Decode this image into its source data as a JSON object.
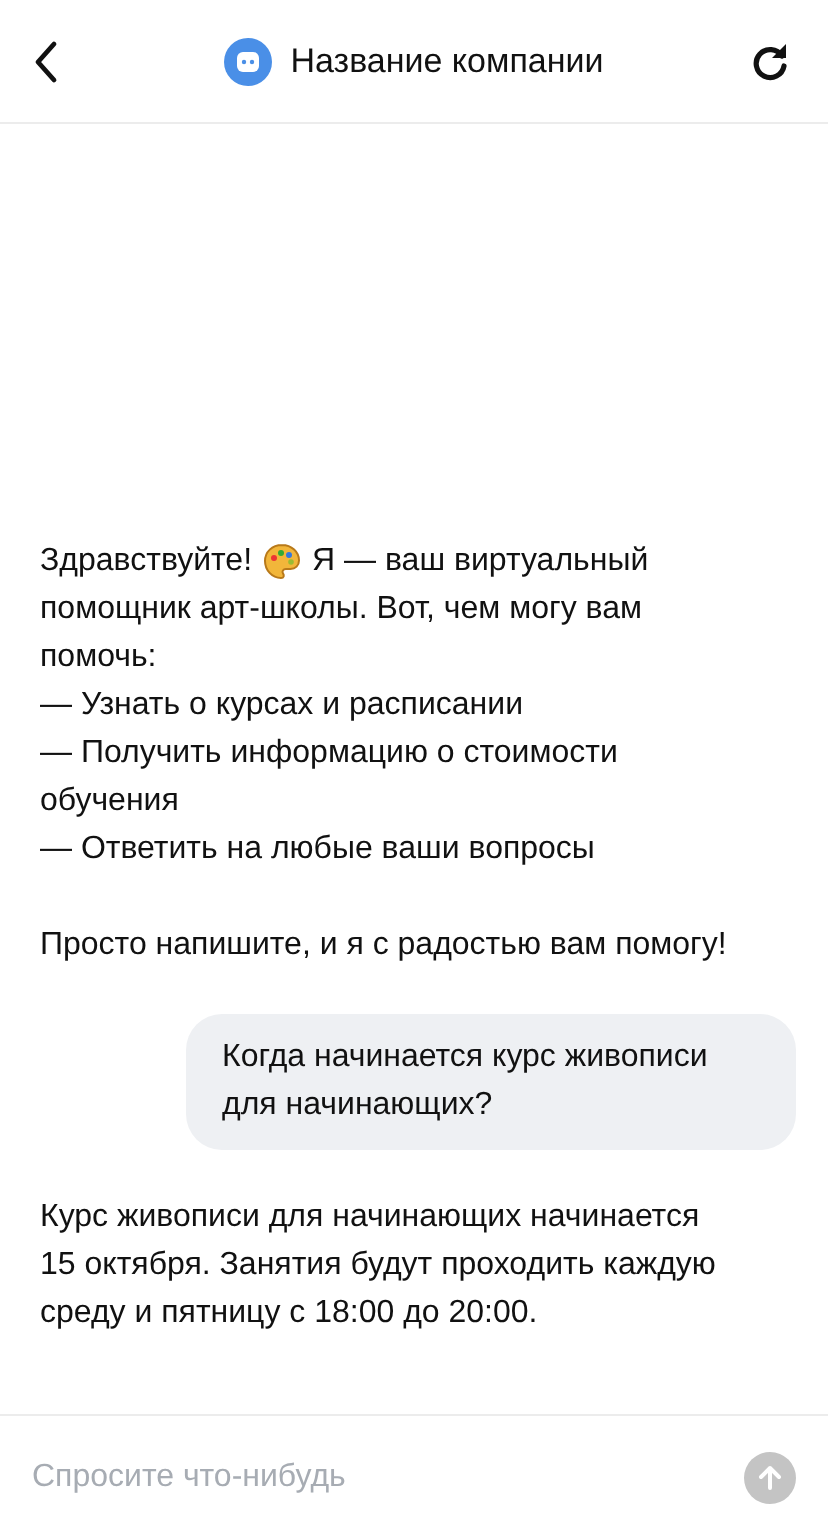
{
  "header": {
    "title": "Название компании"
  },
  "messages": [
    {
      "kind": "bot",
      "greeting": "Здравствуйте!",
      "intro_start": "Я — ваш виртуальный",
      "intro_rest": "помощник арт-школы. Вот, чем могу вам помочь:",
      "items": [
        "— Узнать о курсах и расписании",
        "— Получить информацию о стоимости обучения",
        "— Ответить на любые ваши вопросы"
      ],
      "outro": "Просто напишите, и я с радостью вам помогу!"
    },
    {
      "kind": "user",
      "text": "Когда начинается курс живописи для начинающих?"
    },
    {
      "kind": "bot",
      "text": "Курс живописи для начинающих начинается 15 октября. Занятия будут проходить каждую среду и пятницу с 18:00 до 20:00."
    }
  ],
  "composer": {
    "placeholder": "Спросите что-нибудь"
  }
}
